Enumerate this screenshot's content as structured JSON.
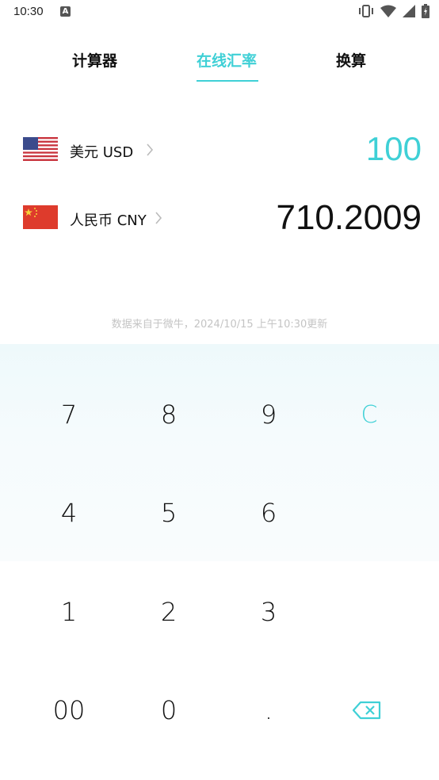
{
  "status_bar": {
    "time": "10:30",
    "notification_icon": "A"
  },
  "tabs": [
    {
      "label": "计算器",
      "active": false
    },
    {
      "label": "在线汇率",
      "active": true
    },
    {
      "label": "换算",
      "active": false
    }
  ],
  "currencies": [
    {
      "flag": "us-flag-icon",
      "label": "美元 USD",
      "amount": "100",
      "color": "#3fd0d6"
    },
    {
      "flag": "cn-flag-icon",
      "label": "人民币 CNY",
      "amount": "710.2009",
      "color": "#111111"
    }
  ],
  "source_note": "数据来自于微牛，2024/10/15 上午10:30更新",
  "keypad": {
    "keys": [
      "7",
      "8",
      "9",
      "C",
      "4",
      "5",
      "6",
      "1",
      "2",
      "3",
      "00",
      "0",
      "."
    ],
    "backspace_icon": "backspace-icon"
  },
  "colors": {
    "accent": "#3fd0d6",
    "note": "#c4c4c4",
    "keypad_bg": "#f3fafc"
  }
}
